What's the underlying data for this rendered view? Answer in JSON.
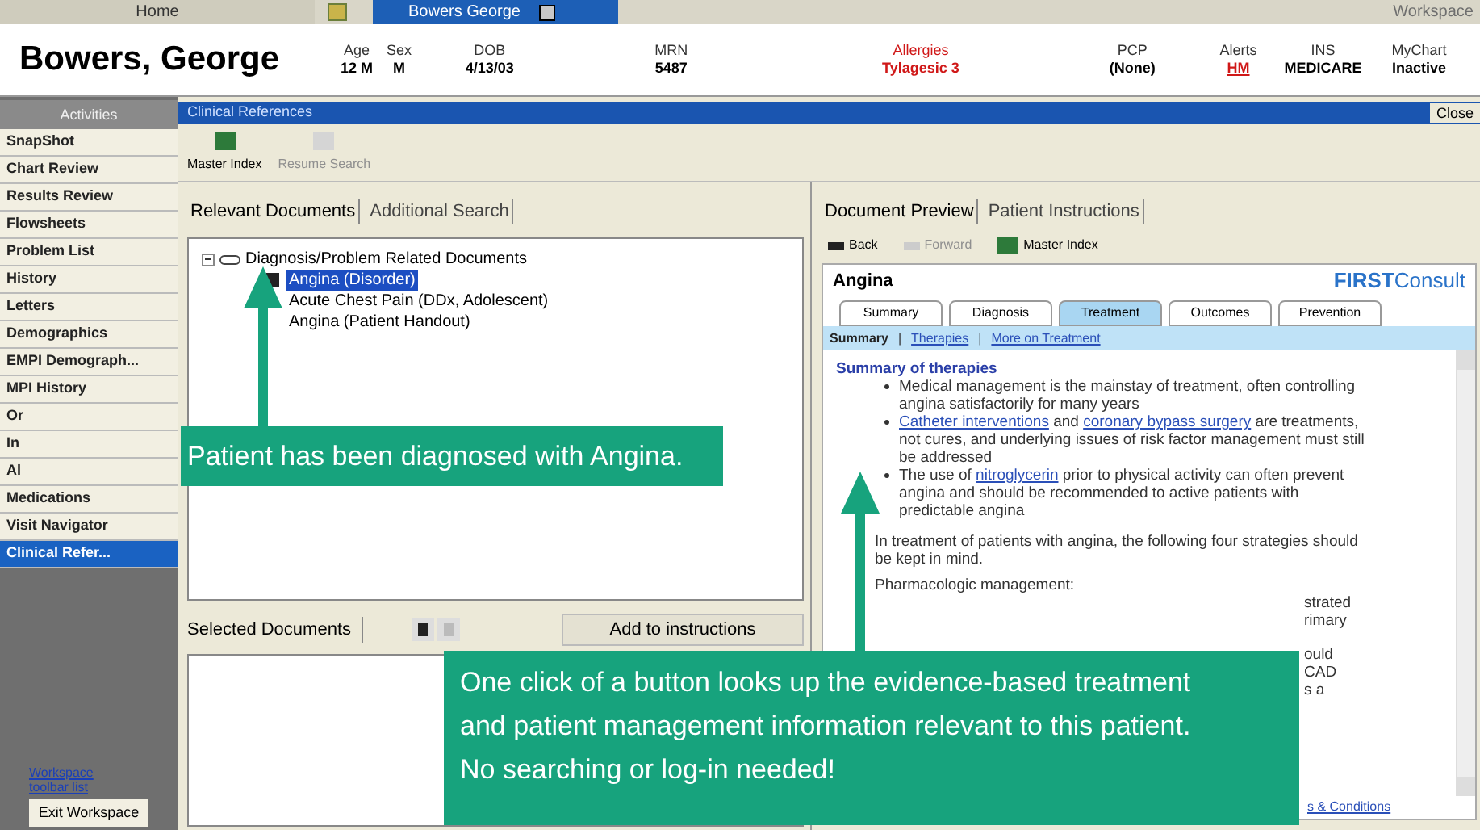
{
  "top_tabs": [
    {
      "label": "Home",
      "selected": false
    },
    {
      "label": "Bowers George",
      "selected": true
    }
  ],
  "workspace_label": "Workspace",
  "patient": {
    "name": "Bowers, George",
    "fields": [
      {
        "label": "Age",
        "value": "12 M",
        "kind": "plain"
      },
      {
        "label": "Sex",
        "value": "M",
        "kind": "plain"
      },
      {
        "label": "DOB",
        "value": "4/13/03",
        "kind": "plain"
      },
      {
        "label": "MRN",
        "value": "5487",
        "kind": "plain"
      },
      {
        "label": "Allergies",
        "value": "Tylagesic 3",
        "kind": "alert"
      },
      {
        "label": "PCP",
        "value": "(None)",
        "kind": "plain"
      },
      {
        "label": "Alerts",
        "value": "HM",
        "kind": "link"
      },
      {
        "label": "INS",
        "value": "MEDICARE",
        "kind": "plain"
      },
      {
        "label": "MyChart",
        "value": "Inactive",
        "kind": "plain"
      }
    ]
  },
  "sidebar": {
    "title": "Activities",
    "items": [
      {
        "label": "SnapShot",
        "selected": false
      },
      {
        "label": "Chart Review",
        "selected": false
      },
      {
        "label": "Results Review",
        "selected": false
      },
      {
        "label": "Flowsheets",
        "selected": false
      },
      {
        "label": "Problem List",
        "selected": false
      },
      {
        "label": "History",
        "selected": false
      },
      {
        "label": "Letters",
        "selected": false
      },
      {
        "label": "Demographics",
        "selected": false
      },
      {
        "label": "EMPI Demograph...",
        "selected": false
      },
      {
        "label": "MPI History",
        "selected": false
      },
      {
        "label": "Or",
        "selected": false
      },
      {
        "label": "In",
        "selected": false
      },
      {
        "label": "Al",
        "selected": false
      },
      {
        "label": "Medications",
        "selected": false
      },
      {
        "label": "Visit Navigator",
        "selected": false
      },
      {
        "label": "Clinical Refer...",
        "selected": true
      }
    ],
    "link_lines": [
      "Workspace",
      "toolbar list"
    ],
    "exit_button": "Exit Workspace"
  },
  "activity": {
    "title": "Clinical References",
    "close": "Close",
    "toolbar": [
      {
        "label": "Master Index",
        "disabled": false
      },
      {
        "label": "Resume Search",
        "disabled": true
      }
    ]
  },
  "left_tabs": [
    {
      "label": "Relevant Documents",
      "selected": true
    },
    {
      "label": "Additional Search",
      "selected": false
    }
  ],
  "tree": {
    "label": "Diagnosis/Problem Related Documents",
    "expanded": true,
    "children": [
      {
        "label": "Angina (Disorder)",
        "selected": true
      },
      {
        "label": "Acute Chest Pain (DDx, Adolescent)",
        "selected": false
      },
      {
        "label": "Angina (Patient Handout)",
        "selected": false
      }
    ]
  },
  "selected_documents": {
    "label": "Selected Documents",
    "add_button": "Add to instructions"
  },
  "right_tabs": [
    {
      "label": "Document Preview",
      "selected": true
    },
    {
      "label": "Patient Instructions",
      "selected": false
    }
  ],
  "nav": [
    {
      "label": "Back",
      "disabled": false,
      "kind": "back"
    },
    {
      "label": "Forward",
      "disabled": true,
      "kind": "forward"
    },
    {
      "label": "Master Index",
      "disabled": false,
      "kind": "index"
    }
  ],
  "document": {
    "title": "Angina",
    "brand_bold": "FIRST",
    "brand_rest": "Consult",
    "tabs": [
      {
        "label": "Summary",
        "selected": false
      },
      {
        "label": "Diagnosis",
        "selected": false
      },
      {
        "label": "Treatment",
        "selected": true
      },
      {
        "label": "Outcomes",
        "selected": false
      },
      {
        "label": "Prevention",
        "selected": false
      }
    ],
    "subnav_separator": "|",
    "subnav": [
      {
        "label": "Summary",
        "selected": true
      },
      {
        "label": "Therapies",
        "selected": false
      },
      {
        "label": "More on Treatment",
        "selected": false
      }
    ],
    "heading": "Summary of therapies",
    "bullets": [
      [
        {
          "text": "Medical management is the mainstay of treatment, often controlling angina satisfactorily for many years",
          "link": false
        }
      ],
      [
        {
          "text": "Catheter interventions",
          "link": true
        },
        {
          "text": " and ",
          "link": false
        },
        {
          "text": "coronary bypass surgery",
          "link": true
        },
        {
          "text": " are treatments, not cures, and underlying issues of risk factor management must still be addressed",
          "link": false
        }
      ],
      [
        {
          "text": "The use of ",
          "link": false
        },
        {
          "text": "nitroglycerin",
          "link": true
        },
        {
          "text": " prior to physical activity can often prevent angina and should be recommended to active patients with predictable angina",
          "link": false
        }
      ]
    ],
    "paragraph": "In treatment of patients with angina, the following four strategies should be kept in mind.",
    "subheading": "Pharmacologic management:",
    "fragments": [
      "strated",
      "rimary",
      "ould",
      "CAD",
      "s a"
    ],
    "footer_link": "s & Conditions"
  },
  "callouts": [
    "Patient has been diagnosed with Angina.",
    "One click of a button looks up the evidence-based treatment and patient management information relevant to this patient. No searching or log-in needed!"
  ]
}
